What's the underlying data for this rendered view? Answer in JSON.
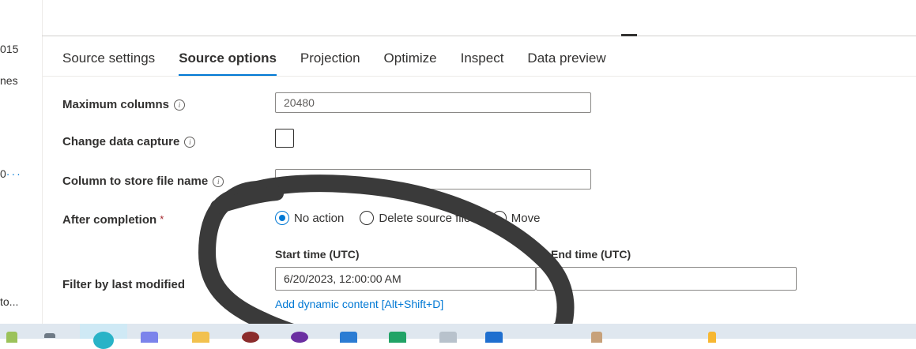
{
  "left_panel": {
    "fragments": [
      "015",
      "nes",
      "0",
      "to..."
    ],
    "more_dots": "···"
  },
  "tabs": [
    {
      "label": "Source settings",
      "active": false
    },
    {
      "label": "Source options",
      "active": true
    },
    {
      "label": "Projection",
      "active": false
    },
    {
      "label": "Optimize",
      "active": false
    },
    {
      "label": "Inspect",
      "active": false
    },
    {
      "label": "Data preview",
      "active": false
    }
  ],
  "form": {
    "max_columns": {
      "label": "Maximum columns",
      "value": "20480"
    },
    "change_data_capture": {
      "label": "Change data capture",
      "checked": false
    },
    "column_file_name": {
      "label": "Column to store file name",
      "value": ""
    },
    "after_completion": {
      "label": "After completion",
      "required_mark": "*",
      "options": [
        "No action",
        "Delete source files",
        "Move"
      ],
      "selected": "No action"
    },
    "filter_last_modified": {
      "label": "Filter by last modified",
      "start_label": "Start time (UTC)",
      "start_value": "6/20/2023, 12:00:00 AM",
      "end_label": "End time (UTC)",
      "end_value": "",
      "dynamic_link": "Add dynamic content [Alt+Shift+D]"
    }
  },
  "info_glyph": "i",
  "colors": {
    "accent": "#0078d4",
    "text": "#323130",
    "required": "#a4262c",
    "scribble": "#3a3a3a",
    "taskbar": "#dfe7ef"
  },
  "taskbar_icons": [
    "windows-widgets-icon",
    "edge-icon",
    "teams-icon",
    "file-explorer-icon",
    "app-icon",
    "app-icon",
    "vscode-icon",
    "excel-icon",
    "app-icon",
    "app-icon",
    "app-icon",
    "app-icon"
  ]
}
